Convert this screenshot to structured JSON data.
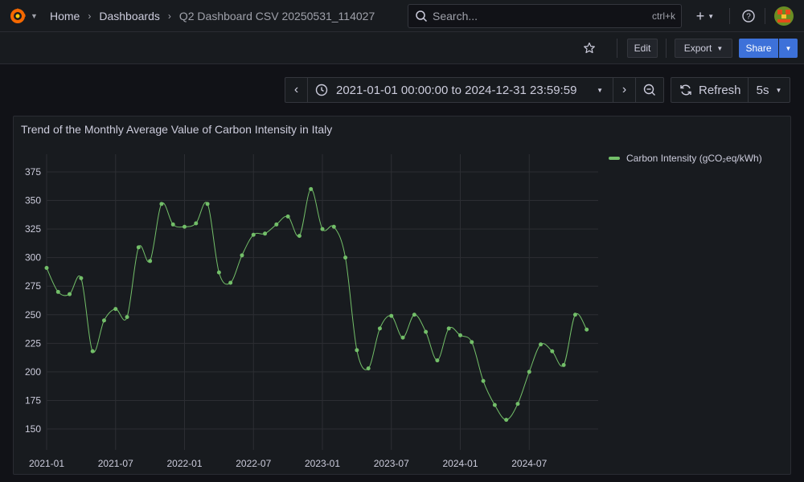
{
  "breadcrumb": {
    "home": "Home",
    "dashboards": "Dashboards",
    "current": "Q2 Dashboard CSV 20250531_114027"
  },
  "search": {
    "placeholder": "Search...",
    "shortcut": "ctrl+k"
  },
  "toolbar": {
    "edit": "Edit",
    "export": "Export",
    "share": "Share"
  },
  "timepicker": {
    "range": "2021-01-01 00:00:00 to 2024-12-31 23:59:59",
    "refresh": "Refresh",
    "interval": "5s"
  },
  "panel": {
    "title": "Trend of the Monthly Average Value of Carbon Intensity in Italy"
  },
  "colors": {
    "accent": "#3d71d9",
    "series": "#73bf69",
    "background": "#111217",
    "panel": "#181b1f"
  },
  "icons": [
    "grafana-logo-icon",
    "search-icon",
    "plus-icon",
    "help-icon",
    "star-icon",
    "chevron-down-icon",
    "chevron-left-icon",
    "chevron-right-icon",
    "clock-icon",
    "zoom-out-icon",
    "refresh-icon"
  ],
  "chart_data": {
    "type": "line",
    "title": "Trend of the Monthly Average Value of Carbon Intensity in Italy",
    "xlabel": "",
    "ylabel": "",
    "ylim": [
      130,
      385
    ],
    "yticks": [
      150,
      175,
      200,
      225,
      250,
      275,
      300,
      325,
      350,
      375
    ],
    "xticks": [
      "2021-01",
      "2021-07",
      "2022-01",
      "2022-07",
      "2023-01",
      "2023-07",
      "2024-01",
      "2024-07"
    ],
    "grid": true,
    "legend_position": "top-right",
    "series": [
      {
        "name": "Carbon Intensity (gCO₂eq/kWh)",
        "x": [
          "2021-01",
          "2021-02",
          "2021-03",
          "2021-04",
          "2021-05",
          "2021-06",
          "2021-07",
          "2021-08",
          "2021-09",
          "2021-10",
          "2021-11",
          "2021-12",
          "2022-01",
          "2022-02",
          "2022-03",
          "2022-04",
          "2022-05",
          "2022-06",
          "2022-07",
          "2022-08",
          "2022-09",
          "2022-10",
          "2022-11",
          "2022-12",
          "2023-01",
          "2023-02",
          "2023-03",
          "2023-04",
          "2023-05",
          "2023-06",
          "2023-07",
          "2023-08",
          "2023-09",
          "2023-10",
          "2023-11",
          "2023-12",
          "2024-01",
          "2024-02",
          "2024-03",
          "2024-04",
          "2024-05",
          "2024-06",
          "2024-07",
          "2024-08",
          "2024-09",
          "2024-10",
          "2024-11",
          "2024-12"
        ],
        "values": [
          291,
          270,
          268,
          282,
          218,
          245,
          255,
          248,
          309,
          297,
          347,
          329,
          327,
          330,
          347,
          287,
          278,
          302,
          320,
          321,
          329,
          336,
          319,
          360,
          325,
          327,
          300,
          219,
          203,
          238,
          249,
          230,
          250,
          235,
          210,
          238,
          232,
          226,
          192,
          171,
          158,
          172,
          200,
          224,
          218,
          206,
          250,
          237
        ]
      }
    ]
  }
}
